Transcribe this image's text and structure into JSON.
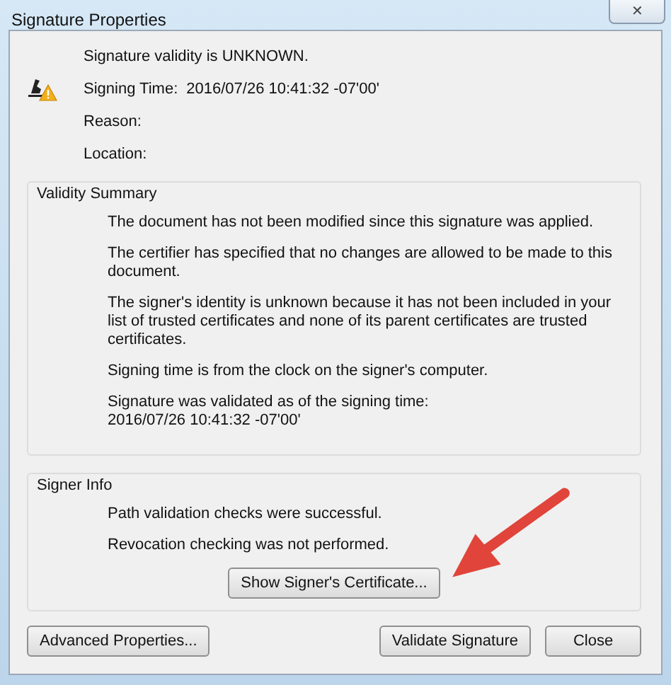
{
  "window": {
    "title": "Signature Properties",
    "close": "✕"
  },
  "header": {
    "status": "Signature validity is UNKNOWN.",
    "fields": [
      {
        "label": "Signing Time:",
        "value": "2016/07/26 10:41:32 -07'00'"
      },
      {
        "label": "Reason:"
      },
      {
        "label": "Location:"
      }
    ]
  },
  "groups": [
    {
      "title": "Validity Summary",
      "paragraphs": [
        "The document has not been modified since this signature was applied.",
        "The certifier has specified that no changes are allowed to be made to this document.",
        "The signer's identity is unknown because it has not been included in your list of trusted certificates and none of its parent certificates are trusted certificates.",
        "Signing time is from the clock on the signer's computer.",
        "Signature was validated as of the signing time:\n2016/07/26 10:41:32 -07'00'"
      ]
    },
    {
      "title": "Signer Info",
      "paragraphs": [
        "Path validation checks were successful.",
        "Revocation checking was not performed."
      ],
      "button": "Show Signer's Certificate..."
    }
  ],
  "buttons": [
    "Advanced Properties...",
    "Validate Signature",
    "Close"
  ]
}
